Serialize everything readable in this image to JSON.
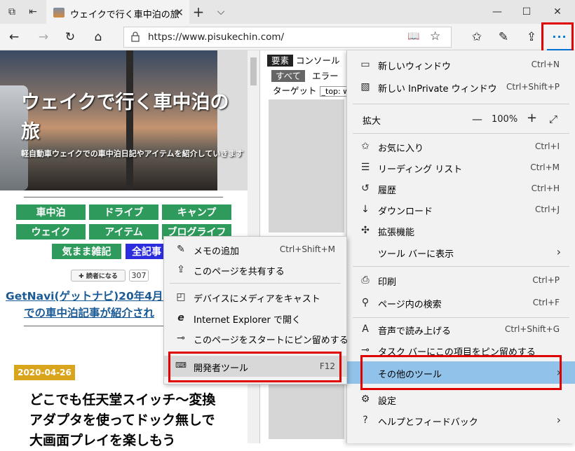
{
  "tab": {
    "title": "ウェイクで行く車中泊の旅",
    "close": "✕",
    "new": "+",
    "list": "⌵"
  },
  "window": {
    "minimize": "—",
    "maximize": "☐",
    "close": "✕"
  },
  "nav": {
    "url": "https://www.pisukechin.com/",
    "more": "···"
  },
  "hero": {
    "title": "ウェイクで行く車中泊の旅",
    "subtitle": "軽自動車ウェイクでの車中泊日記やアイテムを紹介していきます"
  },
  "categories": {
    "row1": [
      "車中泊",
      "ドライブ",
      "キャンプ"
    ],
    "row2": [
      "ウェイク",
      "アイテム",
      "ブログライフ"
    ],
    "row3": [
      "気まま雑記",
      "全記事"
    ]
  },
  "follow": {
    "label": "✚ 読者になる",
    "count": "307"
  },
  "featured": {
    "line1": "GetNavi(ゲットナビ)20年4月号",
    "line2": "での車中泊記事が紹介され"
  },
  "post": {
    "date": "2020-04-26",
    "title": "どこでも任天堂スイッチ〜変換アダプタを使ってドック無しで大画面プレイを楽しもう"
  },
  "devtools": {
    "tab_elements": "要素",
    "tab_console": "コンソール",
    "filter_all": "すべて",
    "filter_error": "エラー",
    "target_label": "ターゲット",
    "target_value": "_top: w"
  },
  "submenu": [
    {
      "label": "メモの追加",
      "shortcut": "Ctrl+Shift+M",
      "icon": "pen-icon"
    },
    {
      "label": "このページを共有する",
      "shortcut": "",
      "icon": "share-icon"
    },
    {
      "label": "デバイスにメディアをキャスト",
      "shortcut": "",
      "icon": "cast-icon"
    },
    {
      "label": "Internet Explorer で開く",
      "shortcut": "",
      "icon": "ie-icon"
    },
    {
      "label": "このページをスタートにピン留めする",
      "shortcut": "",
      "icon": "pin-icon"
    },
    {
      "label": "開発者ツール",
      "shortcut": "F12",
      "icon": "devtools-icon"
    }
  ],
  "mainmenu": {
    "new_window": {
      "label": "新しいウィンドウ",
      "shortcut": "Ctrl+N"
    },
    "new_private": {
      "label": "新しい InPrivate ウィンドウ",
      "shortcut": "Ctrl+Shift+P"
    },
    "zoom": {
      "label": "拡大",
      "minus": "—",
      "value": "100%",
      "plus": "+",
      "expand": "⤢"
    },
    "favorites": {
      "label": "お気に入り",
      "shortcut": "Ctrl+I"
    },
    "reading_list": {
      "label": "リーディング リスト",
      "shortcut": "Ctrl+M"
    },
    "history": {
      "label": "履歴",
      "shortcut": "Ctrl+H"
    },
    "downloads": {
      "label": "ダウンロード",
      "shortcut": "Ctrl+J"
    },
    "extensions": {
      "label": "拡張機能",
      "shortcut": ""
    },
    "show_toolbar": {
      "label": "ツール バーに表示",
      "shortcut": ""
    },
    "print": {
      "label": "印刷",
      "shortcut": "Ctrl+P"
    },
    "find": {
      "label": "ページ内の検索",
      "shortcut": "Ctrl+F"
    },
    "read_aloud": {
      "label": "音声で読み上げる",
      "shortcut": "Ctrl+Shift+G"
    },
    "pin_taskbar": {
      "label": "タスク バーにこの項目をピン留めする",
      "shortcut": ""
    },
    "other_tools": {
      "label": "その他のツール",
      "shortcut": ""
    },
    "settings": {
      "label": "設定",
      "shortcut": ""
    },
    "help": {
      "label": "ヘルプとフィードバック",
      "shortcut": ""
    }
  },
  "colors": {
    "accent": "#0078d7",
    "highlight_box": "#e00000",
    "selected_item": "#91c3ea",
    "category_green": "#2e9a5c",
    "date_badge": "#d8a51c"
  }
}
